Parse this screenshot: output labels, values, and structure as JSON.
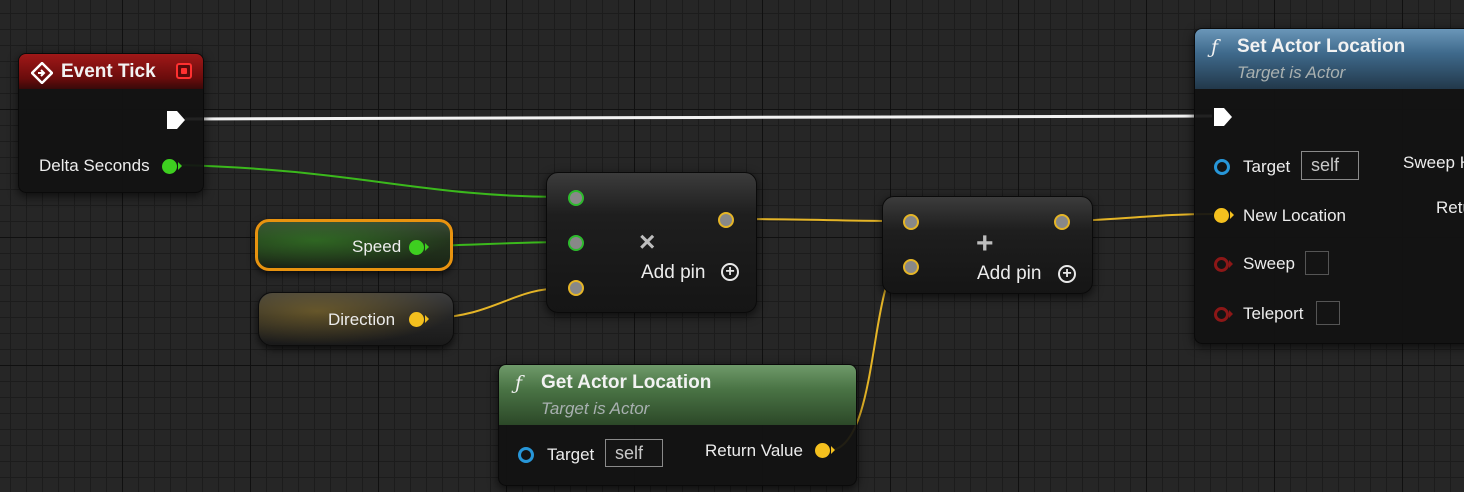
{
  "event_tick": {
    "title": "Event Tick",
    "delta_label": "Delta Seconds"
  },
  "variables": {
    "speed": "Speed",
    "direction": "Direction"
  },
  "multiply_node": {
    "symbol": "×",
    "add_pin": "Add pin"
  },
  "add_node": {
    "symbol": "+",
    "add_pin": "Add pin"
  },
  "get_actor_location": {
    "icon": "ƒ",
    "title": "Get Actor Location",
    "subtitle": "Target is Actor",
    "target_label": "Target",
    "target_value": "self",
    "return_label": "Return Value"
  },
  "set_actor_location": {
    "icon": "ƒ",
    "title": "Set Actor Location",
    "subtitle": "Target is Actor",
    "target_label": "Target",
    "target_value": "self",
    "new_location_label": "New Location",
    "sweep_label": "Sweep",
    "teleport_label": "Teleport",
    "sweep_hit_label": "Sweep Hit Result",
    "return_label": "Return Value"
  },
  "colors": {
    "event_header": "#8a1414",
    "pure_header": "#4a7a45",
    "function_header": "#3f6a8c",
    "float_pin": "#3ecf20",
    "vector_pin": "#f4c01e",
    "object_pin": "#2796d8",
    "bool_pin": "#8c1717",
    "exec_wire": "#ffffff"
  }
}
